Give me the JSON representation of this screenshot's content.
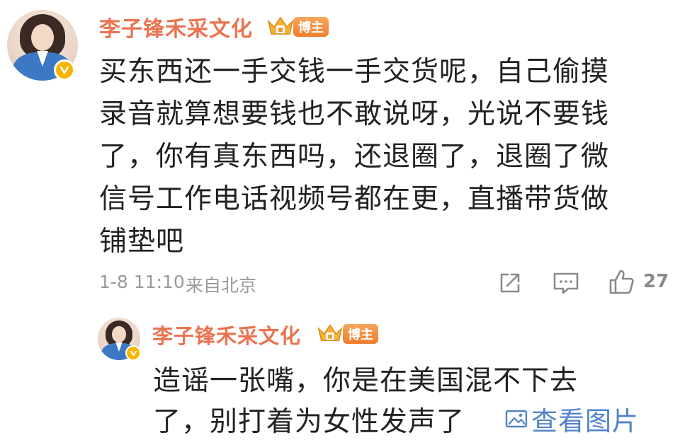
{
  "comment": {
    "author": "李子锋禾采文化",
    "badge": "博主",
    "text_lines": [
      "买东西还一手交钱一手交货呢，自己偷摸",
      "录音就算想要钱也不敢说呀，光说不要钱",
      "了，你有真东西吗，还退圈了，退圈了微",
      "信号工作电话视频号都在更，直播带货做",
      "铺垫吧"
    ],
    "time": "1-8 11:10",
    "source": "来自北京",
    "likes": "27"
  },
  "reply": {
    "author": "李子锋禾采文化",
    "badge": "博主",
    "text_lines": [
      "造谣一张嘴，你是在美国混不下去",
      "了，别打着为女性发声了"
    ],
    "view_image": "查看图片"
  },
  "colors": {
    "name": "#eb7350",
    "link": "#5183c8",
    "meta": "#9a9a9a",
    "verified": "#f7b500"
  },
  "icons": [
    "verified-icon",
    "crown-icon",
    "share-icon",
    "comment-icon",
    "like-icon",
    "image-icon"
  ]
}
